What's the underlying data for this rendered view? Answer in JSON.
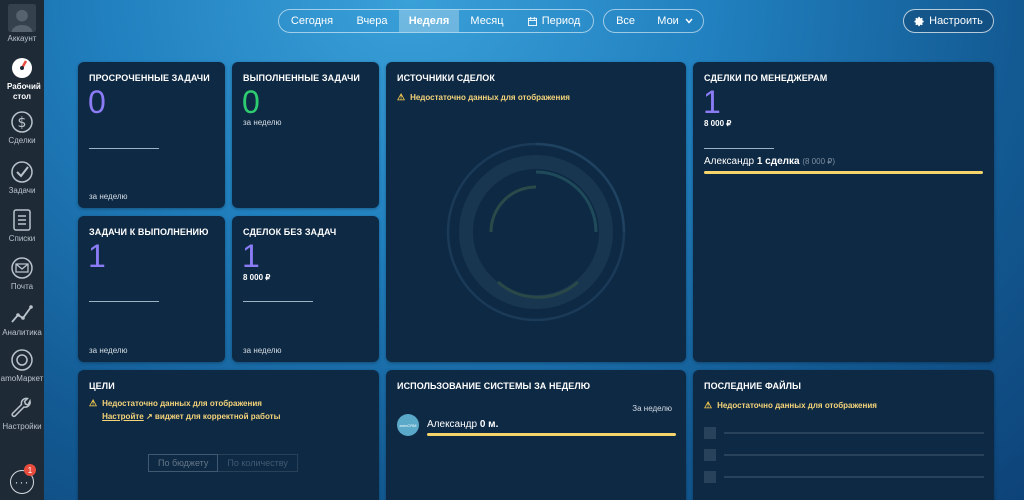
{
  "sidebar": {
    "items": [
      {
        "label": "Аккаунт"
      },
      {
        "label": "Рабочий стол"
      },
      {
        "label": "Сделки"
      },
      {
        "label": "Задачи"
      },
      {
        "label": "Списки"
      },
      {
        "label": "Почта"
      },
      {
        "label": "Аналитика"
      },
      {
        "label": "amoМаркет"
      },
      {
        "label": "Настройки"
      }
    ],
    "chat_badge": "1"
  },
  "periods": [
    "Сегодня",
    "Вчера",
    "Неделя",
    "Месяц",
    "Период"
  ],
  "active_period": "Неделя",
  "who": [
    "Все",
    "Мои"
  ],
  "settings_label": "Настроить",
  "widgets": {
    "overdue": {
      "title": "Просроченные задачи",
      "value": "0",
      "footer": "за неделю"
    },
    "done": {
      "title": "Выполненные задачи",
      "value": "0",
      "sub": "за неделю"
    },
    "todo": {
      "title": "Задачи к выполнению",
      "value": "1",
      "footer": "за неделю"
    },
    "no_tasks": {
      "title": "Сделок без задач",
      "value": "1",
      "amount": "8 000 ₽",
      "footer": "за неделю"
    },
    "sources": {
      "title": "Источники сделок",
      "warning": "Недостаточно данных для отображения"
    },
    "managers": {
      "title": "Сделки по менеджерам",
      "value": "1",
      "amount": "8 000 ₽",
      "row_name": "Александр",
      "row_deals": "1 сделка",
      "row_sum": "(8 000 ₽)"
    },
    "goals": {
      "title": "Цели",
      "warning": "Недостаточно данных для отображения",
      "link": "Настройте",
      "link_rest": "виджет для корректной работы",
      "tab1": "По бюджету",
      "tab2": "По количеству"
    },
    "usage": {
      "title": "Использование системы за неделю",
      "period": "За неделю",
      "user": "Александр",
      "time": "0 м."
    },
    "files": {
      "title": "Последние файлы",
      "warning": "Недостаточно данных для отображения"
    }
  },
  "colors": {
    "purple": "#8b7cf6",
    "green": "#2ecc71",
    "yellow": "#f5d46b",
    "bg": "#0e2944"
  }
}
